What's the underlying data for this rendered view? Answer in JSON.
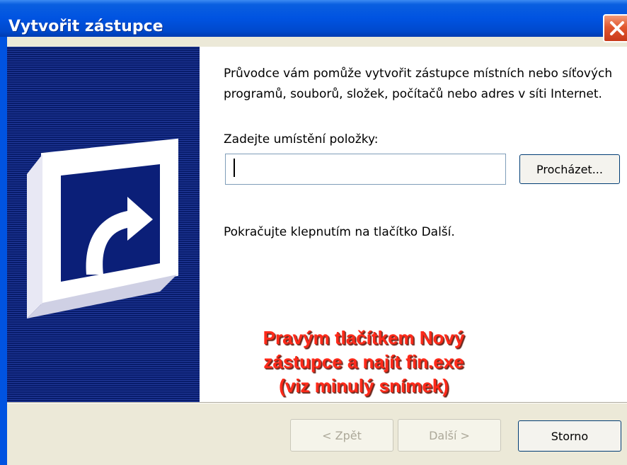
{
  "window": {
    "title": "Vytvořit zástupce"
  },
  "wizard": {
    "description": "Průvodce vám pomůže vytvořit zástupce místních nebo síťových programů, souborů, složek, počítačů nebo adres v síti Internet.",
    "location_label": "Zadejte umístění položky:",
    "location_value": "",
    "browse_label": "Procházet...",
    "hint": "Pokračujte klepnutím na tlačítko Další."
  },
  "annotation": {
    "line1": "Pravým tlačítkem Nový",
    "line2": "zástupce a najít fin.exe",
    "line3": "(viz minulý snímek)",
    "color": "#ff2a1a"
  },
  "footer": {
    "back_label": "< Zpět",
    "next_label": "Další >",
    "cancel_label": "Storno"
  },
  "icons": {
    "close": "close-icon",
    "shortcut": "shortcut-arrow-icon"
  },
  "colors": {
    "titlebar": "#0053e1",
    "panel": "#0d2a86",
    "dialog_bg": "#ece9d8"
  }
}
